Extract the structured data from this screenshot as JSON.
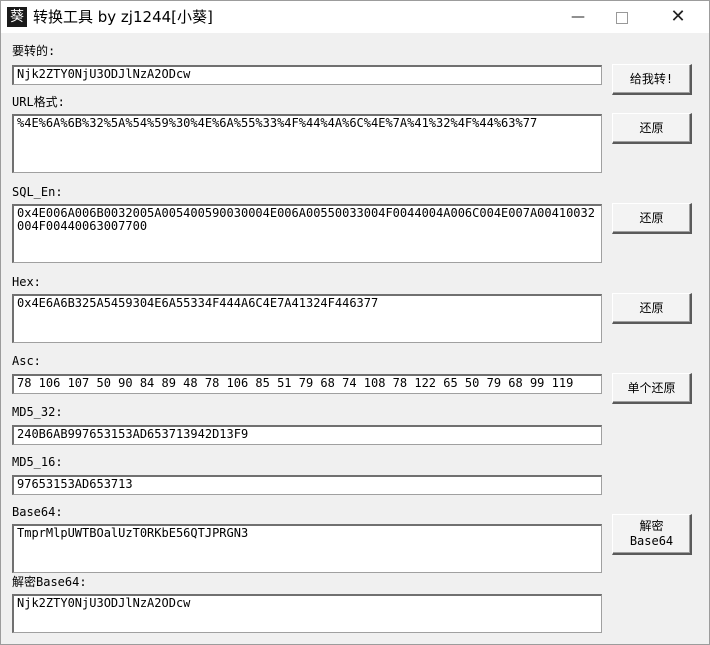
{
  "window": {
    "title": "转换工具 by zj1244[小葵]",
    "icon_glyph": "葵",
    "minimize": "—",
    "close": "✕"
  },
  "rows": {
    "yaozhuan": {
      "label": "要转的:",
      "value": "Njk2ZTY0NjU3ODJlNzA2ODcw",
      "button": "给我转!"
    },
    "url": {
      "label": "URL格式:",
      "value": "%4E%6A%6B%32%5A%54%59%30%4E%6A%55%33%4F%44%4A%6C%4E%7A%41%32%4F%44%63%77",
      "button": "还原"
    },
    "sql": {
      "label": "SQL_En:",
      "value": "0x4E006A006B0032005A005400590030004E006A00550033004F0044004A006C004E007A00410032004F00440063007700",
      "button": "还原"
    },
    "hex": {
      "label": "Hex:",
      "value": "0x4E6A6B325A5459304E6A55334F444A6C4E7A41324F446377",
      "button": "还原"
    },
    "asc": {
      "label": "Asc:",
      "value": "78 106 107 50 90 84 89 48 78 106 85 51 79 68 74 108 78 122 65 50 79 68 99 119",
      "button": "单个还原"
    },
    "md5_32": {
      "label": "MD5_32:",
      "value": "240B6AB997653153AD653713942D13F9"
    },
    "md5_16": {
      "label": "MD5_16:",
      "value": "97653153AD653713"
    },
    "base64": {
      "label": "Base64:",
      "value": "TmprMlpUWTBOalUzT0RKbE56QTJPRGN3",
      "button": "解密\nBase64"
    },
    "decode64": {
      "label": "解密Base64:",
      "value": "Njk2ZTY0NjU3ODJlNzA2ODcw"
    }
  }
}
